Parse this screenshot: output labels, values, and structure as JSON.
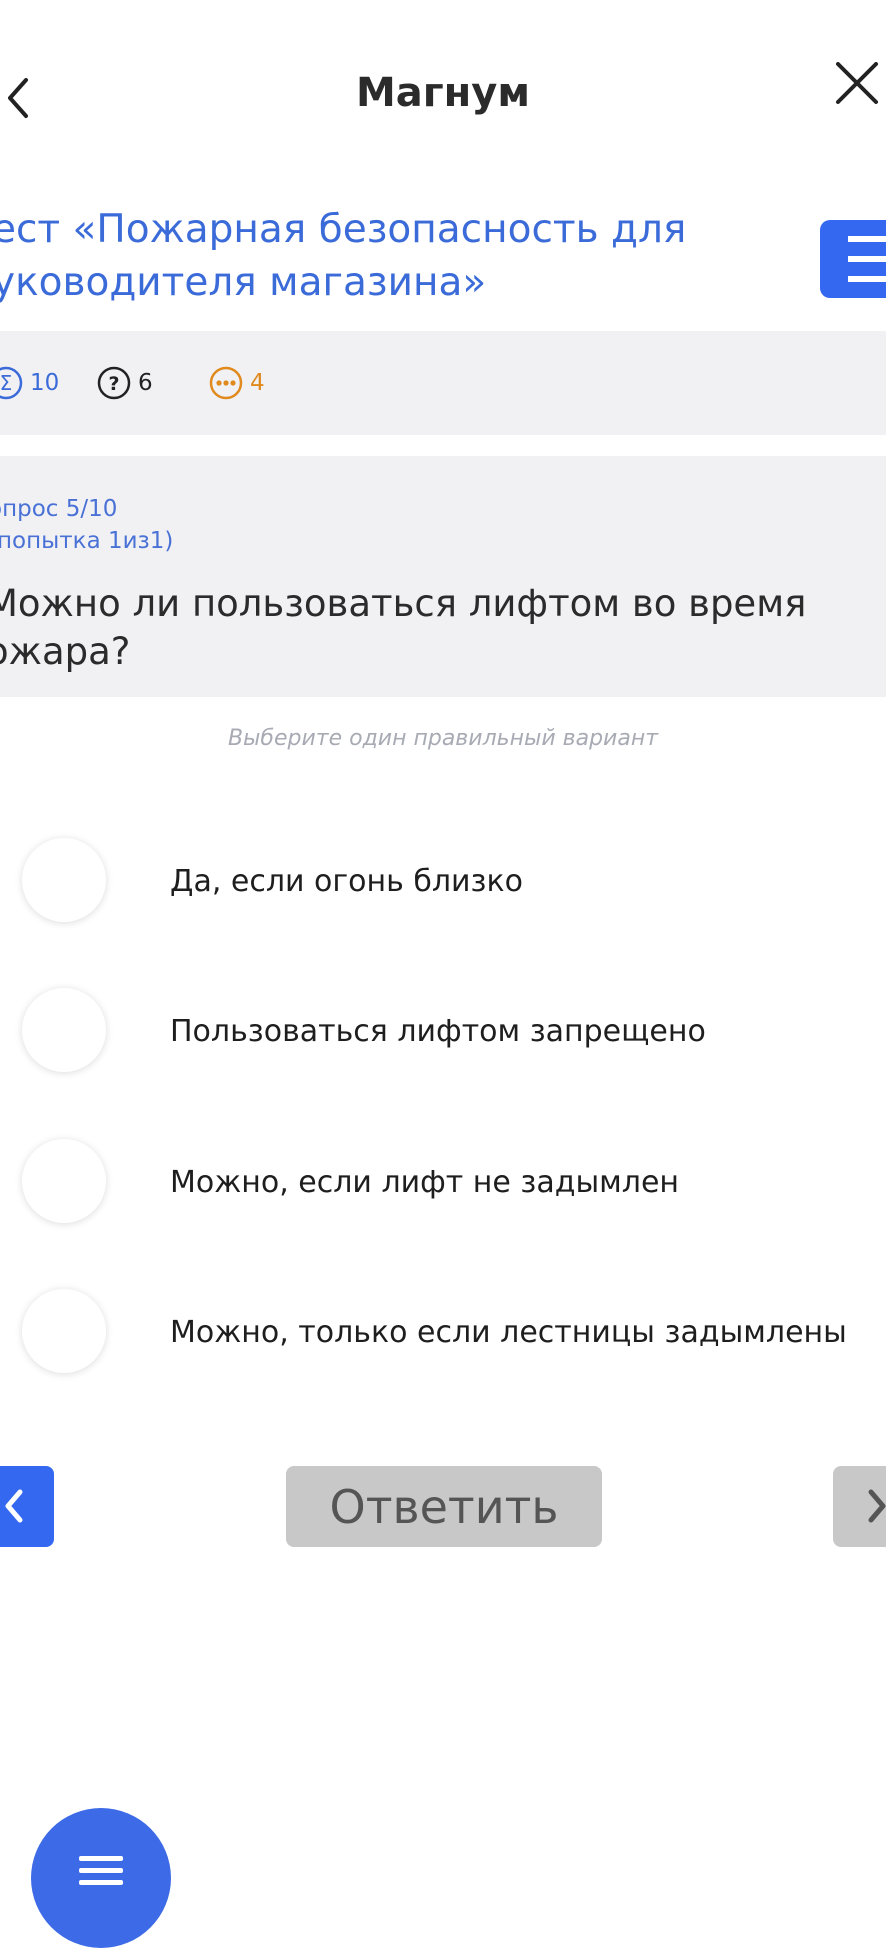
{
  "header": {
    "title": "Магнум",
    "back_icon": "chevron-left-icon",
    "close_icon": "close-icon"
  },
  "test": {
    "title_line1": "ест «Пожарная безопасность для",
    "title_line2": "уководителя магазина»",
    "menu_icon": "hamburger-icon"
  },
  "stats": {
    "total": "10",
    "unanswered": "6",
    "pending": "4"
  },
  "question": {
    "number": "опрос 5/10",
    "attempt": "(попытка 1из1)",
    "text_line1": "Можно ли пользоваться лифтом во время",
    "text_line2": "ожара?"
  },
  "hint": "Выберите один правильный вариант",
  "options": [
    {
      "label": "Да, если огонь близко"
    },
    {
      "label": "Пользоваться лифтом запрещено"
    },
    {
      "label": "Можно, если лифт не задымлен"
    },
    {
      "label": "Можно, только если лестницы задымлены"
    }
  ],
  "actions": {
    "answer_label": "Ответить"
  },
  "colors": {
    "accent": "#3568f0",
    "link_text": "#3b6bd8",
    "warning": "#e08a1e",
    "disabled": "#c8c8c8"
  }
}
